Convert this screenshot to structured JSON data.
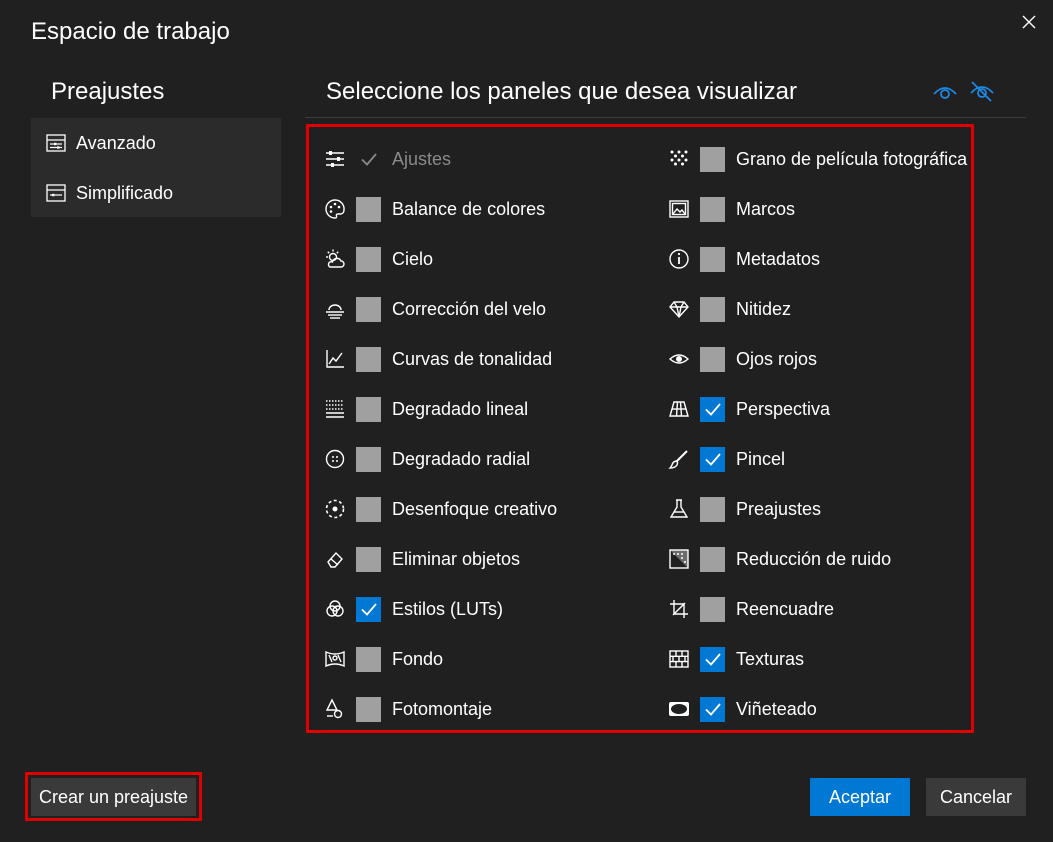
{
  "dialog": {
    "title": "Espacio de trabajo"
  },
  "presets": {
    "heading": "Preajustes",
    "items": [
      {
        "label": "Avanzado",
        "icon": "advanced-layout-icon"
      },
      {
        "label": "Simplificado",
        "icon": "simple-layout-icon"
      }
    ]
  },
  "panels": {
    "heading": "Seleccione los paneles que desea visualizar",
    "accent_color": "#0078d4",
    "highlight_color": "#e00000",
    "left": [
      {
        "label": "Ajustes",
        "icon": "sliders-icon",
        "state": "locked"
      },
      {
        "label": "Balance de colores",
        "icon": "palette-icon",
        "state": "unchecked"
      },
      {
        "label": "Cielo",
        "icon": "sun-cloud-icon",
        "state": "unchecked"
      },
      {
        "label": "Corrección del velo",
        "icon": "haze-icon",
        "state": "unchecked"
      },
      {
        "label": "Curvas de tonalidad",
        "icon": "curve-chart-icon",
        "state": "unchecked"
      },
      {
        "label": "Degradado lineal",
        "icon": "linear-gradient-icon",
        "state": "unchecked"
      },
      {
        "label": "Degradado radial",
        "icon": "radial-gradient-icon",
        "state": "unchecked"
      },
      {
        "label": "Desenfoque creativo",
        "icon": "creative-blur-icon",
        "state": "unchecked"
      },
      {
        "label": "Eliminar objetos",
        "icon": "eraser-icon",
        "state": "unchecked"
      },
      {
        "label": "Estilos (LUTs)",
        "icon": "color-circles-icon",
        "state": "checked"
      },
      {
        "label": "Fondo",
        "icon": "background-icon",
        "state": "unchecked"
      },
      {
        "label": "Fotomontaje",
        "icon": "photomontage-icon",
        "state": "unchecked"
      }
    ],
    "right": [
      {
        "label": "Grano de película fotográfica",
        "icon": "grain-dots-icon",
        "state": "unchecked"
      },
      {
        "label": "Marcos",
        "icon": "frame-image-icon",
        "state": "unchecked"
      },
      {
        "label": "Metadatos",
        "icon": "info-icon",
        "state": "unchecked"
      },
      {
        "label": "Nitidez",
        "icon": "diamond-icon",
        "state": "unchecked"
      },
      {
        "label": "Ojos rojos",
        "icon": "eye-icon",
        "state": "unchecked"
      },
      {
        "label": "Perspectiva",
        "icon": "perspective-grid-icon",
        "state": "checked"
      },
      {
        "label": "Pincel",
        "icon": "brush-icon",
        "state": "checked"
      },
      {
        "label": "Preajustes",
        "icon": "flask-icon",
        "state": "unchecked"
      },
      {
        "label": "Reducción de ruido",
        "icon": "noise-reduction-icon",
        "state": "unchecked"
      },
      {
        "label": "Reencuadre",
        "icon": "crop-icon",
        "state": "unchecked"
      },
      {
        "label": "Texturas",
        "icon": "brick-texture-icon",
        "state": "checked"
      },
      {
        "label": "Viñeteado",
        "icon": "vignette-icon",
        "state": "checked"
      }
    ]
  },
  "footer": {
    "create_preset": "Crear un preajuste",
    "accept": "Aceptar",
    "cancel": "Cancelar"
  }
}
